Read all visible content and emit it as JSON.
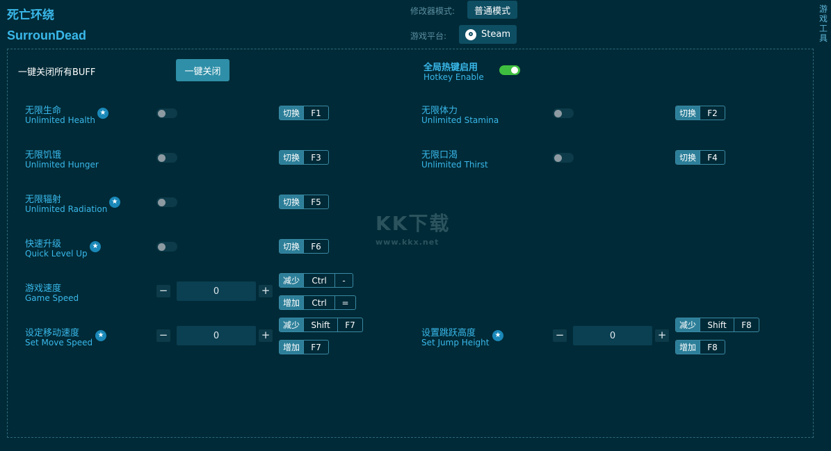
{
  "header": {
    "title_cn": "死亡环绕",
    "title_en": "SurrounDead",
    "mode_label": "修改器模式:",
    "mode_value": "普通模式",
    "platform_label": "游戏平台:",
    "platform_value": "Steam",
    "side_tab": [
      "游",
      "戏",
      "工",
      "具"
    ]
  },
  "global": {
    "disable_all_label": "一键关闭所有BUFF",
    "disable_all_button": "一键关闭",
    "hotkey_enable_cn": "全局热键启用",
    "hotkey_enable_en": "Hotkey Enable",
    "hotkey_enabled": true
  },
  "tag_toggle": "切换",
  "tag_decrease": "减少",
  "tag_increase": "增加",
  "options": {
    "health": {
      "cn": "无限生命",
      "en": "Unlimited Health",
      "key": "F1",
      "starred": true,
      "on": false
    },
    "stamina": {
      "cn": "无限体力",
      "en": "Unlimited Stamina",
      "key": "F2",
      "starred": false,
      "on": false
    },
    "hunger": {
      "cn": "无限饥饿",
      "en": "Unlimited Hunger",
      "key": "F3",
      "starred": false,
      "on": false
    },
    "thirst": {
      "cn": "无限口渴",
      "en": "Unlimited Thirst",
      "key": "F4",
      "starred": false,
      "on": false
    },
    "radiation": {
      "cn": "无限辐射",
      "en": "Unlimited Radiation",
      "key": "F5",
      "starred": true,
      "on": false
    },
    "levelup": {
      "cn": "快速升级",
      "en": "Quick Level Up",
      "key": "F6",
      "starred": true,
      "on": false
    }
  },
  "sliders": {
    "game_speed": {
      "cn": "游戏速度",
      "en": "Game Speed",
      "value": "0",
      "dec_mod": "Ctrl",
      "dec_key": "-",
      "inc_mod": "Ctrl",
      "inc_key": "="
    },
    "move_speed": {
      "cn": "设定移动速度",
      "en": "Set Move Speed",
      "value": "0",
      "dec_mod": "Shift",
      "dec_key": "F7",
      "inc_key": "F7",
      "starred": true
    },
    "jump_height": {
      "cn": "设置跳跃高度",
      "en": "Set Jump Height",
      "value": "0",
      "dec_mod": "Shift",
      "dec_key": "F8",
      "inc_key": "F8",
      "starred": true
    }
  },
  "stepper": {
    "minus": "−",
    "plus": "+"
  },
  "star_glyph": "★",
  "watermark": {
    "main": "KK下载",
    "sub": "www.kkx.net"
  },
  "colors": {
    "accent": "#3ab8ea",
    "background": "#002a37",
    "toggle_on": "#3fbf3f"
  }
}
